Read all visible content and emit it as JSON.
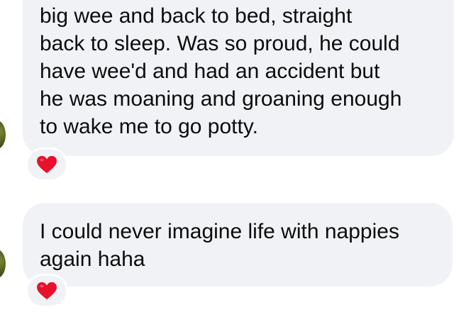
{
  "messages": [
    {
      "text": "big wee and back to bed, straight\nback to sleep. Was so proud, he could\nhave wee'd and had an accident but\nhe was moaning and groaning enough\nto wake me to go potty.",
      "reaction": "heart-icon"
    },
    {
      "text": "I could never imagine life with nappies\nagain haha",
      "reaction": "heart-icon"
    }
  ],
  "colors": {
    "bubble": "#f1f2f6",
    "text": "#0c0c0c",
    "heart": "#e8102a"
  }
}
